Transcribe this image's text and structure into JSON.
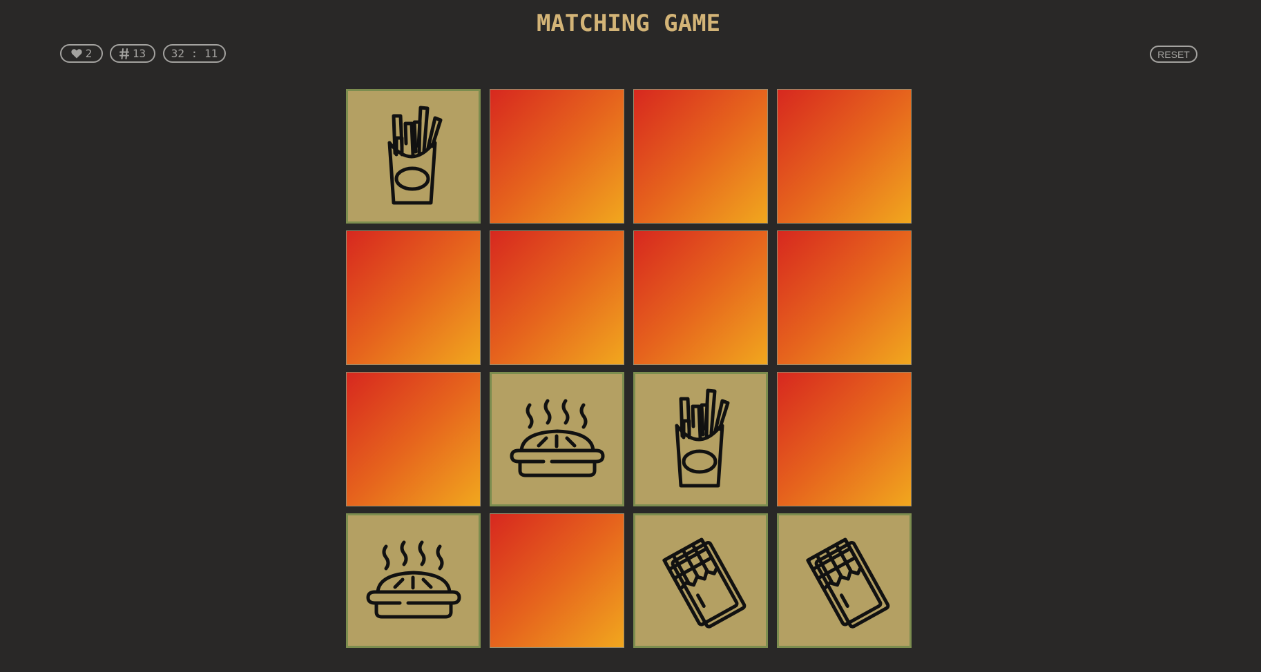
{
  "header": {
    "title": "MATCHING GAME"
  },
  "stats": {
    "lives_icon": "heart-icon",
    "lives": "2",
    "moves_icon": "hash-icon",
    "moves": "13",
    "timer": "32 : 11"
  },
  "controls": {
    "reset_label": "RESET"
  },
  "colors": {
    "background": "#292827",
    "title": "#d3b477",
    "card_back_gradient": [
      "#d7281f",
      "#e6641d",
      "#f1a71e"
    ],
    "card_face": "#b4a063",
    "card_face_border": "#7c8d4f",
    "stat_outline": "#a4a3a0"
  },
  "board": {
    "rows": 4,
    "cols": 4,
    "cards": [
      {
        "state": "revealed",
        "icon": "fries-icon"
      },
      {
        "state": "hidden",
        "icon": ""
      },
      {
        "state": "hidden",
        "icon": ""
      },
      {
        "state": "hidden",
        "icon": ""
      },
      {
        "state": "hidden",
        "icon": ""
      },
      {
        "state": "hidden",
        "icon": ""
      },
      {
        "state": "hidden",
        "icon": ""
      },
      {
        "state": "hidden",
        "icon": ""
      },
      {
        "state": "hidden",
        "icon": ""
      },
      {
        "state": "revealed",
        "icon": "pie-icon"
      },
      {
        "state": "revealed",
        "icon": "fries-icon"
      },
      {
        "state": "hidden",
        "icon": ""
      },
      {
        "state": "revealed",
        "icon": "pie-icon"
      },
      {
        "state": "hidden",
        "icon": ""
      },
      {
        "state": "revealed",
        "icon": "chocolate-icon"
      },
      {
        "state": "revealed",
        "icon": "chocolate-icon"
      }
    ]
  }
}
